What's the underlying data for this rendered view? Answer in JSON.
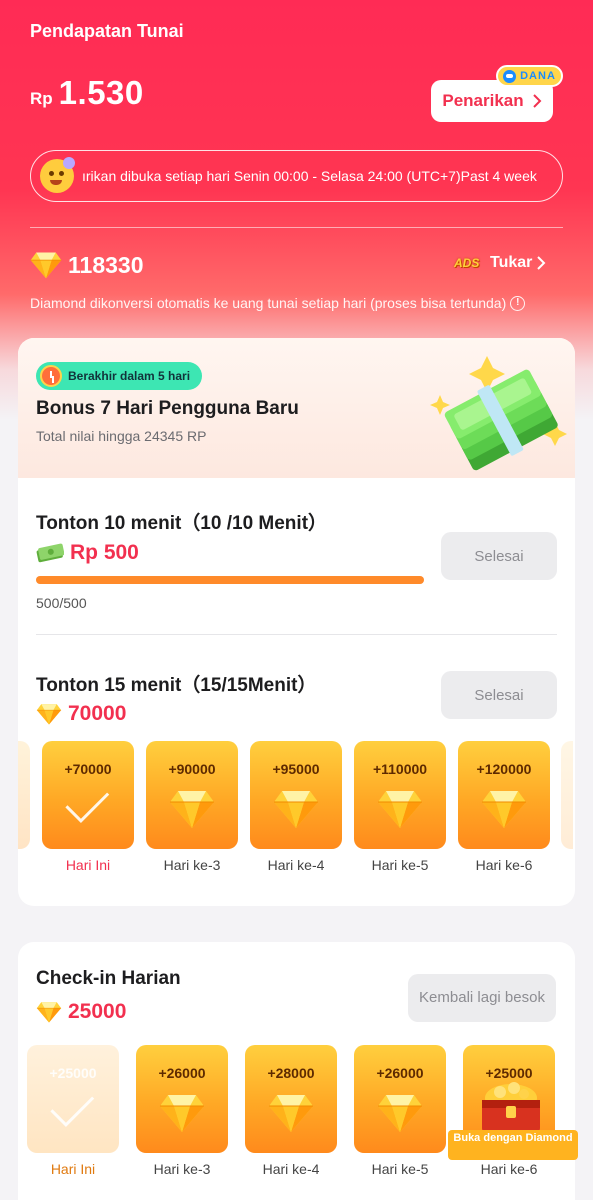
{
  "header": {
    "title": "Pendapatan Tunai",
    "currency": "Rp",
    "balance": "1.530",
    "withdraw_label": "Penarikan",
    "withdraw_badge": "DANA",
    "notice": "ırikan dibuka setiap hari Senin 00:00 - Selasa 24:00 (UTC+7)Past 4 week"
  },
  "diamonds": {
    "count": "118330",
    "exchange_logo": "ADS",
    "exchange_label": "Tukar",
    "note": "Diamond dikonversi otomatis ke uang tunai setiap hari (proses bisa tertunda)",
    "info_glyph": "!"
  },
  "bonus": {
    "badge": "Berakhir dalam 5 hari",
    "title": "Bonus 7 Hari Pengguna Baru",
    "subtitle": "Total nilai hingga 24345 RP"
  },
  "task1": {
    "title": "Tonton 10 menit（10 /10 Menit）",
    "reward": "Rp 500",
    "button": "Selesai",
    "progress_text": "500/500",
    "progress_fraction": 1.0
  },
  "task2": {
    "title": "Tonton 15 menit（15/15Menit）",
    "reward": "70000",
    "button": "Selesai",
    "days": [
      {
        "value": "+70000",
        "label": "Hari Ini",
        "done": true
      },
      {
        "value": "+90000",
        "label": "Hari ke-3",
        "done": false
      },
      {
        "value": "+95000",
        "label": "Hari ke-4",
        "done": false
      },
      {
        "value": "+110000",
        "label": "Hari ke-5",
        "done": false
      },
      {
        "value": "+120000",
        "label": "Hari ke-6",
        "done": false
      }
    ]
  },
  "checkin": {
    "title": "Check-in Harian",
    "reward": "25000",
    "button": "Kembali lagi besok",
    "days": [
      {
        "value": "+25000",
        "label": "Hari Ini",
        "done": true
      },
      {
        "value": "+26000",
        "label": "Hari ke-3",
        "done": false
      },
      {
        "value": "+28000",
        "label": "Hari ke-4",
        "done": false
      },
      {
        "value": "+26000",
        "label": "Hari ke-5",
        "done": false
      },
      {
        "value": "+25000",
        "label": "Hari ke-6",
        "done": false
      }
    ],
    "chest_label": "Buka dengan Diamond"
  },
  "colors": {
    "accent_red": "#f2304f",
    "progress_orange": "#ff8a2a",
    "badge_green": "#3de6b3"
  },
  "icons": [
    "dana-logo-icon",
    "chevron-right-icon",
    "emoji-speaker-icon",
    "diamond-icon",
    "ads-logo-icon",
    "info-icon",
    "clock-icon",
    "money-stack-icon",
    "cash-icon",
    "check-icon",
    "treasure-chest-icon"
  ]
}
